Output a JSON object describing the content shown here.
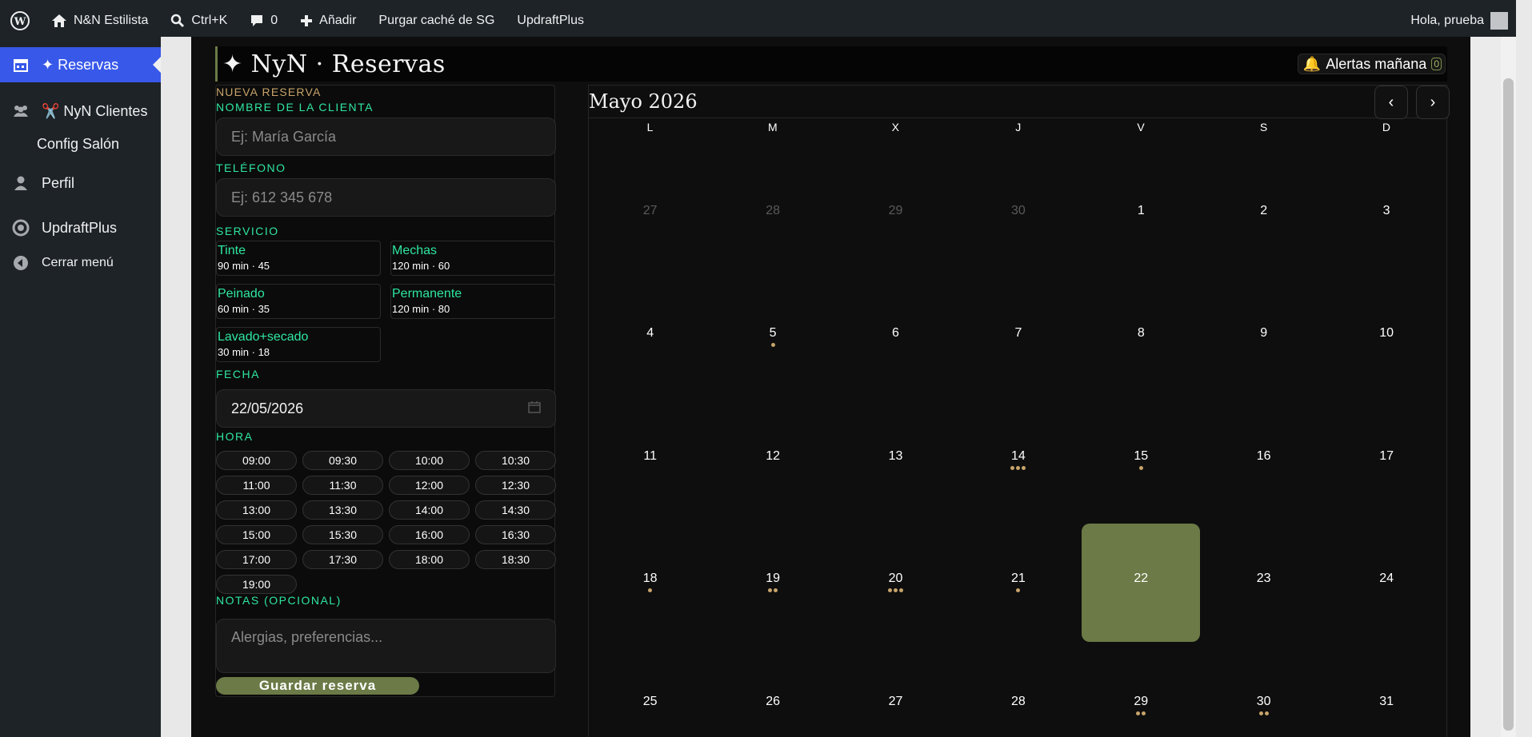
{
  "adminbar": {
    "site_name": "N&N Estilista",
    "search_shortcut": "Ctrl+K",
    "comments_count": "0",
    "add_new": "Añadir",
    "purge_cache": "Purgar caché de SG",
    "updraft": "UpdraftPlus",
    "greeting": "Hola, prueba"
  },
  "sidebar": {
    "items": [
      {
        "label": "✦ Reservas",
        "icon": "calendar-icon"
      },
      {
        "label": "✂️ NyN Clientes",
        "icon": "users-icon"
      },
      {
        "label": "Config Salón",
        "icon": ""
      },
      {
        "label": "Perfil",
        "icon": "user-icon"
      },
      {
        "label": "UpdraftPlus",
        "icon": "updraft-icon"
      },
      {
        "label": "Cerrar menú",
        "icon": "collapse-icon"
      }
    ]
  },
  "header": {
    "title": "✦ NyN · Reservas",
    "alert_label": "Alertas mañana",
    "alert_count": "0"
  },
  "form": {
    "section_title": "NUEVA RESERVA",
    "name_label": "NOMBRE DE LA CLIENTA",
    "name_placeholder": "Ej: María García",
    "phone_label": "TELÉFONO",
    "phone_placeholder": "Ej: 612 345 678",
    "service_label": "SERVICIO",
    "services": [
      {
        "name": "Tinte",
        "detail": "90 min · 45"
      },
      {
        "name": "Mechas",
        "detail": "120 min · 60"
      },
      {
        "name": "Peinado",
        "detail": "60 min · 35"
      },
      {
        "name": "Permanente",
        "detail": "120 min · 80"
      },
      {
        "name": "Lavado+secado",
        "detail": "30 min · 18"
      }
    ],
    "date_label": "FECHA",
    "date_value": "22/05/2026",
    "time_label": "HORA",
    "times": [
      "09:00",
      "09:30",
      "10:00",
      "10:30",
      "11:00",
      "11:30",
      "12:00",
      "12:30",
      "13:00",
      "13:30",
      "14:00",
      "14:30",
      "15:00",
      "15:30",
      "16:00",
      "16:30",
      "17:00",
      "17:30",
      "18:00",
      "18:30",
      "19:00"
    ],
    "notes_label": "NOTAS (OPCIONAL)",
    "notes_placeholder": "Alergias, preferencias...",
    "save_label": "Guardar reserva"
  },
  "calendar": {
    "month_label": "Mayo 2026",
    "prev": "‹",
    "next": "›",
    "weekdays": [
      "L",
      "M",
      "X",
      "J",
      "V",
      "S",
      "D"
    ],
    "selected_day": "22",
    "days": [
      {
        "n": "27",
        "muted": true,
        "dots": 0
      },
      {
        "n": "28",
        "muted": true,
        "dots": 0
      },
      {
        "n": "29",
        "muted": true,
        "dots": 0
      },
      {
        "n": "30",
        "muted": true,
        "dots": 0
      },
      {
        "n": "1",
        "dots": 0
      },
      {
        "n": "2",
        "dots": 0
      },
      {
        "n": "3",
        "dots": 0
      },
      {
        "n": "4",
        "dots": 0
      },
      {
        "n": "5",
        "dots": 1
      },
      {
        "n": "6",
        "dots": 0
      },
      {
        "n": "7",
        "dots": 0
      },
      {
        "n": "8",
        "dots": 0
      },
      {
        "n": "9",
        "dots": 0
      },
      {
        "n": "10",
        "dots": 0
      },
      {
        "n": "11",
        "dots": 0
      },
      {
        "n": "12",
        "dots": 0
      },
      {
        "n": "13",
        "dots": 0
      },
      {
        "n": "14",
        "dots": 3
      },
      {
        "n": "15",
        "dots": 1
      },
      {
        "n": "16",
        "dots": 0
      },
      {
        "n": "17",
        "dots": 0
      },
      {
        "n": "18",
        "dots": 1
      },
      {
        "n": "19",
        "dots": 2
      },
      {
        "n": "20",
        "dots": 3
      },
      {
        "n": "21",
        "dots": 1
      },
      {
        "n": "22",
        "dots": 0
      },
      {
        "n": "23",
        "dots": 0
      },
      {
        "n": "24",
        "dots": 0
      },
      {
        "n": "25",
        "dots": 0
      },
      {
        "n": "26",
        "dots": 0
      },
      {
        "n": "27",
        "dots": 0
      },
      {
        "n": "28",
        "dots": 0
      },
      {
        "n": "29",
        "dots": 2
      },
      {
        "n": "30",
        "dots": 2
      },
      {
        "n": "31",
        "dots": 0
      }
    ]
  },
  "colors": {
    "accent_green": "#2fe6a0",
    "olive": "#6b7a46",
    "gold": "#c7a46a",
    "wp_blue": "#3858e9"
  }
}
